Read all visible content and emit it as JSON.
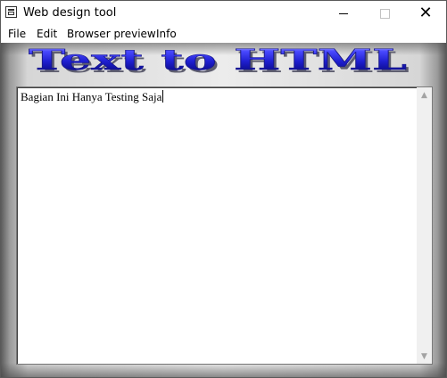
{
  "window": {
    "title": "Web design tool"
  },
  "menu": {
    "items": [
      "File",
      "Edit",
      "Browser preview",
      "Info"
    ]
  },
  "banner": {
    "text": "Text to HTML"
  },
  "editor": {
    "content": "Bagian Ini Hanya Testing Saja"
  },
  "icons": {
    "app": "window-app-icon",
    "minimize": "minimize-icon",
    "maximize": "maximize-icon",
    "close": "close-icon",
    "scroll_up": "scroll-up-arrow-icon",
    "scroll_down": "scroll-down-arrow-icon"
  },
  "colors": {
    "banner_fill": "#2a2adf",
    "banner_shadow": "#6b6b7d"
  }
}
